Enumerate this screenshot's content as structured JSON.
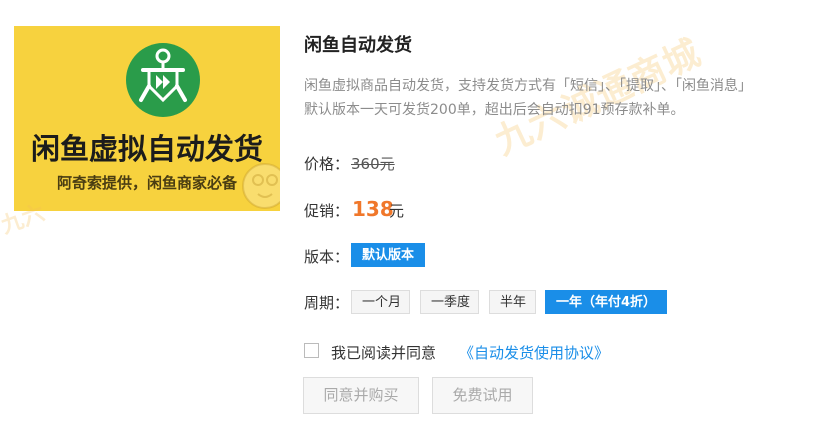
{
  "banner": {
    "title": "闲鱼虚拟自动发货",
    "subtitle": "阿奇索提供，闲鱼商家必备"
  },
  "product": {
    "title": "闲鱼自动发货",
    "desc_line1": "闲鱼虚拟商品自动发货，支持发货方式有「短信」、「提取」、「闲鱼消息」",
    "desc_line2": "默认版本一天可发货200单，超出后会自动扣91预存款补单。"
  },
  "price": {
    "label": "价格：",
    "original": "360元",
    "promo_label": "促销：",
    "promo_value": "138",
    "promo_unit": "元"
  },
  "version": {
    "label": "版本：",
    "options": [
      "默认版本"
    ],
    "selected": "默认版本"
  },
  "period": {
    "label": "周期：",
    "options": [
      "一个月",
      "一季度",
      "半年",
      "一年（年付4折）"
    ],
    "selected": "一年（年付4折）"
  },
  "agreement": {
    "text": "我已阅读并同意",
    "link": "《自动发货使用协议》",
    "checked": false
  },
  "buttons": {
    "buy": "同意并购买",
    "trial": "免费试用"
  },
  "watermark": {
    "main": "九六诚通商城",
    "left": "九六"
  },
  "colors": {
    "accent": "#1a8ee8",
    "promo": "#f0772a",
    "banner_bg": "#f7d23e",
    "logo_green": "#2a9c4a"
  }
}
